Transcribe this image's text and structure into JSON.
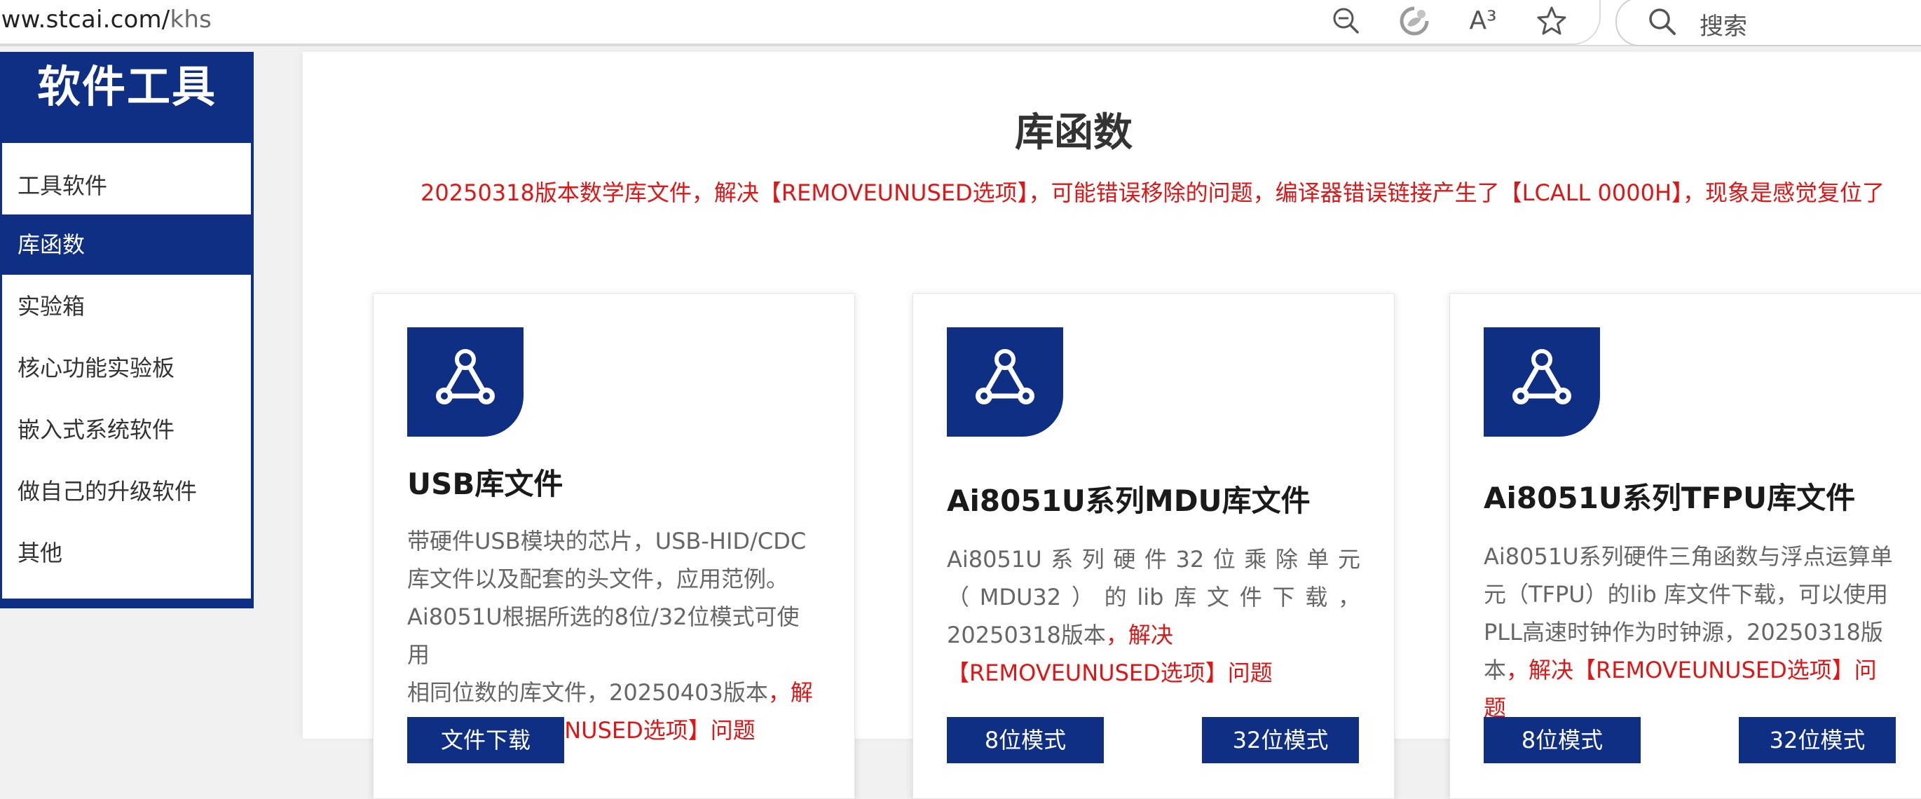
{
  "browser": {
    "url_host": "/www.stcai.com/",
    "url_path": "khs",
    "icons": [
      "zoom-out-icon",
      "copilot-icon",
      "read-aloud-icon",
      "favorite-star-icon"
    ],
    "read_aloud_glyph": "A³",
    "search_placeholder": "搜索"
  },
  "sidebar": {
    "title": "软件工具",
    "items": [
      {
        "label": "工具软件",
        "active": false
      },
      {
        "label": "库函数",
        "active": true
      },
      {
        "label": "实验箱",
        "active": false
      },
      {
        "label": "核心功能实验板",
        "active": false
      },
      {
        "label": "嵌入式系统软件",
        "active": false
      },
      {
        "label": "做自己的升级软件",
        "active": false
      },
      {
        "label": "其他",
        "active": false
      }
    ]
  },
  "main": {
    "title": "库函数",
    "notice": "20250318版本数学库文件，解决【REMOVEUNUSED选项】，可能错误移除的问题，编译器错误链接产生了【LCALL  0000H】，现象是感觉复位了"
  },
  "cards": [
    {
      "icon": "share-nodes-icon",
      "title": "USB库文件",
      "desc_lines": [
        "带硬件USB模块的芯片，USB-HID/CDC",
        "库文件以及配套的头文件，应用范例。",
        "Ai8051U根据所选的8位/32位模式可使用",
        "相同位数的库文件，20250403版本"
      ],
      "desc_red": "，解决【REMOVEUNUSED选项】问题",
      "buttons": [
        "文件下载"
      ]
    },
    {
      "icon": "share-nodes-icon",
      "title": "Ai8051U系列MDU库文件",
      "desc_lines": [
        "Ai8051U系列硬件32位乘除单元",
        "（MDU32）的lib库文件下载，",
        "20250318版本"
      ],
      "desc_red": "，解决【REMOVEUNUSED选项】问题",
      "buttons": [
        "8位模式",
        "32位模式"
      ]
    },
    {
      "icon": "share-nodes-icon",
      "title": "Ai8051U系列TFPU库文件",
      "desc_lines": [
        "Ai8051U系列硬件三角函数与浮点运算单",
        "元（TFPU）的lib 库文件下载，可以使用",
        "PLL高速时钟作为时钟源，20250318版",
        "本"
      ],
      "desc_red": "，解决【REMOVEUNUSED选项】问题",
      "buttons": [
        "8位模式",
        "32位模式"
      ]
    }
  ],
  "colors": {
    "brand_blue": "#0f2f84",
    "notice_red": "#e01515"
  }
}
